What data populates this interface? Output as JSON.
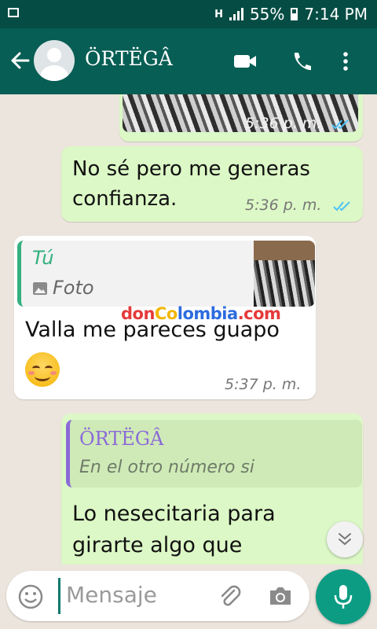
{
  "status_bar": {
    "network": "H",
    "battery": "55%",
    "time": "7:14 PM"
  },
  "header": {
    "contact_name": "ÖRTËGÂ"
  },
  "messages": [
    {
      "time": "5:36 p. m."
    },
    {
      "text": "No sé pero me generas confianza.",
      "time": "5:36 p. m."
    },
    {
      "quote_author": "Tú",
      "quote_text": "Foto",
      "text": "Valla me pareces guapo",
      "time": "5:37 p. m."
    },
    {
      "quote_author": "ÖRTËGÂ",
      "quote_text": "En el otro número si",
      "text_line1": "Lo nesecitaria para",
      "text_line2": "girarte algo que"
    }
  ],
  "watermark": {
    "part1": "don",
    "part2": "Co",
    "part3": "lombia",
    "part4": ".com"
  },
  "composer": {
    "placeholder": "Mensaje"
  },
  "colors": {
    "header": "#075e54",
    "status_bar": "#054d44",
    "outgoing": "#dcf8c6",
    "incoming": "#ffffff",
    "read_ticks": "#4fc3f7",
    "fab": "#0b9c83"
  },
  "icons": [
    "back-arrow-icon",
    "video-call-icon",
    "phone-icon",
    "more-vert-icon",
    "image-icon",
    "emoji-icon",
    "attach-icon",
    "camera-icon",
    "mic-icon",
    "chevron-down-icon"
  ]
}
